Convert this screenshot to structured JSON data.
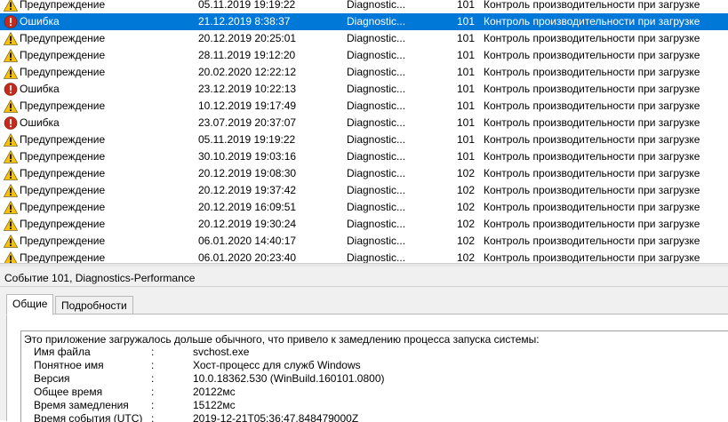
{
  "event_list": {
    "rows": [
      {
        "level": "Предупреждение",
        "type": "warning",
        "date": "05.11.2019 19:19:22",
        "source": "Diagnostic...",
        "id": "101",
        "task": "Контроль производительности при загрузке"
      },
      {
        "level": "Ошибка",
        "type": "error",
        "date": "21.12.2019 8:38:37",
        "source": "Diagnostic...",
        "id": "101",
        "task": "Контроль производительности при загрузке",
        "selected": true
      },
      {
        "level": "Предупреждение",
        "type": "warning",
        "date": "20.12.2019 20:25:01",
        "source": "Diagnostic...",
        "id": "101",
        "task": "Контроль производительности при загрузке"
      },
      {
        "level": "Предупреждение",
        "type": "warning",
        "date": "28.11.2019 19:12:20",
        "source": "Diagnostic...",
        "id": "101",
        "task": "Контроль производительности при загрузке"
      },
      {
        "level": "Предупреждение",
        "type": "warning",
        "date": "20.02.2020 12:22:12",
        "source": "Diagnostic...",
        "id": "101",
        "task": "Контроль производительности при загрузке"
      },
      {
        "level": "Ошибка",
        "type": "error",
        "date": "23.12.2019 10:22:13",
        "source": "Diagnostic...",
        "id": "101",
        "task": "Контроль производительности при загрузке"
      },
      {
        "level": "Предупреждение",
        "type": "warning",
        "date": "10.12.2019 19:17:49",
        "source": "Diagnostic...",
        "id": "101",
        "task": "Контроль производительности при загрузке"
      },
      {
        "level": "Ошибка",
        "type": "error",
        "date": "23.07.2019 20:37:07",
        "source": "Diagnostic...",
        "id": "101",
        "task": "Контроль производительности при загрузке"
      },
      {
        "level": "Предупреждение",
        "type": "warning",
        "date": "05.11.2019 19:19:22",
        "source": "Diagnostic...",
        "id": "101",
        "task": "Контроль производительности при загрузке"
      },
      {
        "level": "Предупреждение",
        "type": "warning",
        "date": "30.10.2019 19:03:16",
        "source": "Diagnostic...",
        "id": "101",
        "task": "Контроль производительности при загрузке"
      },
      {
        "level": "Предупреждение",
        "type": "warning",
        "date": "20.12.2019 19:08:30",
        "source": "Diagnostic...",
        "id": "102",
        "task": "Контроль производительности при загрузке"
      },
      {
        "level": "Предупреждение",
        "type": "warning",
        "date": "20.12.2019 19:37:42",
        "source": "Diagnostic...",
        "id": "102",
        "task": "Контроль производительности при загрузке"
      },
      {
        "level": "Предупреждение",
        "type": "warning",
        "date": "20.12.2019 16:09:51",
        "source": "Diagnostic...",
        "id": "102",
        "task": "Контроль производительности при загрузке"
      },
      {
        "level": "Предупреждение",
        "type": "warning",
        "date": "20.12.2019 19:30:24",
        "source": "Diagnostic...",
        "id": "102",
        "task": "Контроль производительности при загрузке"
      },
      {
        "level": "Предупреждение",
        "type": "warning",
        "date": "06.01.2020 14:40:17",
        "source": "Diagnostic...",
        "id": "102",
        "task": "Контроль производительности при загрузке"
      },
      {
        "level": "Предупреждение",
        "type": "warning",
        "date": "06.01.2020 20:23:40",
        "source": "Diagnostic...",
        "id": "102",
        "task": "Контроль производительности при загрузке"
      }
    ]
  },
  "details": {
    "title": "Событие 101, Diagnostics-Performance",
    "tabs": [
      "Общие",
      "Подробности"
    ],
    "description": "Это приложение загружалось дольше обычного, что привело к замедлению процесса запуска системы:",
    "properties": [
      {
        "key": "Имя файла",
        "sep": ":",
        "value": "svchost.exe"
      },
      {
        "key": "Понятное имя",
        "sep": ":",
        "value": "Хост-процесс для служб Windows"
      },
      {
        "key": "Версия",
        "sep": ":",
        "value": "10.0.18362.530 (WinBuild.160101.0800)"
      },
      {
        "key": "Общее время",
        "sep": ":",
        "value": "20122мс"
      },
      {
        "key": "Время замедления",
        "sep": ":",
        "value": "15122мс"
      },
      {
        "key": "Время события (UTC)",
        "sep": ":",
        "value": "2019-12-21T05:36:47.848479000Z"
      }
    ]
  },
  "icons": {
    "warning": "warning-icon",
    "error": "error-icon"
  },
  "colors": {
    "selection": "#0078d7",
    "warning": "#f7c200",
    "error": "#c42b1c"
  }
}
